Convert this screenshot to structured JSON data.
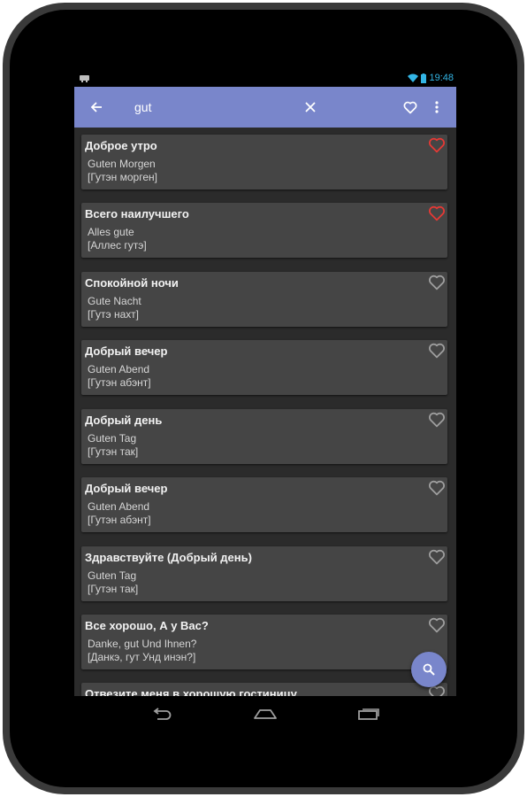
{
  "status_bar": {
    "time": "19:48",
    "icons": [
      "notification-icon",
      "wifi-icon",
      "battery-icon"
    ]
  },
  "toolbar": {
    "search_query": "gut",
    "icons": [
      "back-arrow-icon",
      "clear-icon",
      "favorite-icon",
      "overflow-menu-icon"
    ]
  },
  "phrases": [
    {
      "title": "Доброе утро",
      "phrase": "Guten Morgen",
      "translit": "[Гутэн морген]",
      "favorite": true
    },
    {
      "title": "Всего наилучшего",
      "phrase": "Alles gute",
      "translit": "[Аллес гутэ]",
      "favorite": true
    },
    {
      "title": "Спокойной ночи",
      "phrase": "Gute Nacht",
      "translit": "[Гутэ нахт]",
      "favorite": false
    },
    {
      "title": "Добрый вечер",
      "phrase": "Guten Abend",
      "translit": "[Гутэн абэнт]",
      "favorite": false
    },
    {
      "title": "Добрый день",
      "phrase": "Guten Tag",
      "translit": "[Гутэн так]",
      "favorite": false
    },
    {
      "title": "Добрый вечер",
      "phrase": "Guten Abend",
      "translit": "[Гутэн абэнт]",
      "favorite": false
    },
    {
      "title": "Здравствуйте (Добрый день)",
      "phrase": "Guten Tag",
      "translit": "[Гутэн так]",
      "favorite": false
    },
    {
      "title": "Все хорошо, А у Вас?",
      "phrase": "Danke, gut Und Ihnen?",
      "translit": "[Данкэ, гут Унд инэн?]",
      "favorite": false
    },
    {
      "title": "Отвезите меня в хорошую гостиницу",
      "phrase": "",
      "translit": "",
      "favorite": false
    }
  ],
  "fab": {
    "icon": "search-icon"
  },
  "nav_bar": {
    "icons": [
      "back-icon",
      "home-icon",
      "recent-apps-icon"
    ]
  },
  "colors": {
    "toolbar": "#7986cb",
    "fab": "#7986cb",
    "card": "#454545",
    "list_background": "#2b2b2b",
    "favorite_heart": "#e53935",
    "heart_outline": "#9e9e9e",
    "status_text": "#33b5e5"
  }
}
